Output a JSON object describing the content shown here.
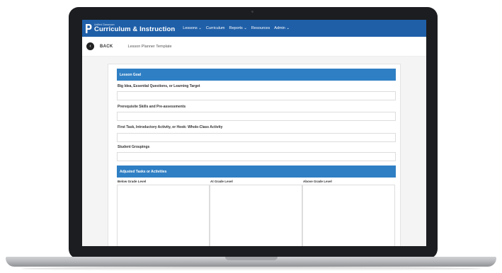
{
  "app": {
    "logo_small": "Unified Classroom",
    "logo_main": "Curriculum & Instruction"
  },
  "nav": {
    "items": [
      "Lessons ⌄",
      "Curriculum",
      "Reports ⌄",
      "Resources",
      "Admin ⌄"
    ]
  },
  "subheader": {
    "back_label": "BACK",
    "page_title": "Lesson Planner Template"
  },
  "lesson_goal": {
    "header": "Lesson Goal",
    "fields": [
      "Big Idea, Essential Questions, or Learning Target",
      "Prerequisite Skills and Pre-assessments",
      "First Task, Introductory Activity, or Hook: Whole-Class Activity",
      "Student Groupings"
    ]
  },
  "adjusted": {
    "header": "Adjusted Tasks or Activities",
    "columns": [
      "Below Grade Level",
      "At Grade Level",
      "Above Grade Level"
    ]
  },
  "colors": {
    "navbar": "#1f5fa8",
    "section_header": "#2f7fc4",
    "laptop_bezel": "#1c1d20"
  }
}
